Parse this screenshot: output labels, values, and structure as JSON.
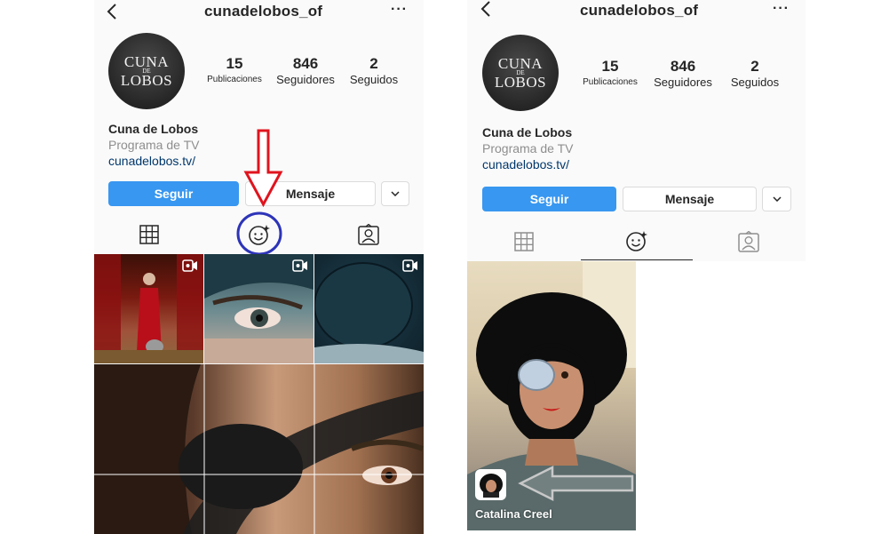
{
  "profile": {
    "username": "cunadelobos_of",
    "back_icon": "back-chevron-icon",
    "more_label": "···",
    "avatar_logo": {
      "top": "CUNA",
      "middle": "DE",
      "bottom": "LOBOS"
    },
    "stats": [
      {
        "value": "15",
        "label": "Publicaciones"
      },
      {
        "value": "846",
        "label": "Seguidores"
      },
      {
        "value": "2",
        "label": "Seguidos"
      }
    ],
    "name": "Cuna de Lobos",
    "category": "Programa de TV",
    "link": "cunadelobos.tv/",
    "follow_label": "Seguir",
    "message_label": "Mensaje",
    "tabs": [
      {
        "icon": "grid-icon"
      },
      {
        "icon": "effects-face-icon"
      },
      {
        "icon": "tagged-person-icon"
      }
    ]
  },
  "effect_preview": {
    "creator_name": "Catalina Creel"
  },
  "colors": {
    "follow_blue": "#3897f0",
    "annotation_red": "#e0141e",
    "annotation_blue": "#2d34b8",
    "link_blue": "#00376b"
  }
}
